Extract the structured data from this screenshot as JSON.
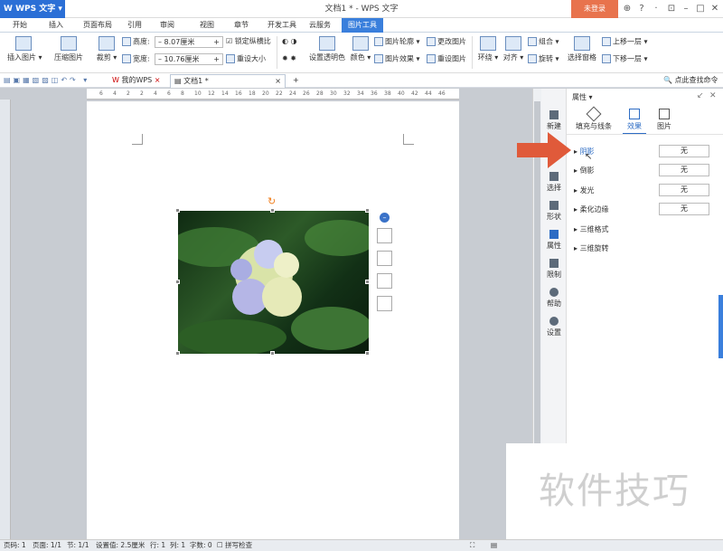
{
  "app": {
    "name": "WPS 文字",
    "doc_title": "文档1 * - WPS 文字",
    "login": "未登录"
  },
  "tabs": [
    "开始",
    "插入",
    "页面布局",
    "引用",
    "审阅",
    "视图",
    "章节",
    "开发工具",
    "云服务",
    "图片工具"
  ],
  "active_tab": "图片工具",
  "ribbon": {
    "insert_image": "插入图片",
    "compress": "压缩图片",
    "crop": "裁剪",
    "height_label": "高度:",
    "height_value": "8.07厘米",
    "width_label": "宽度:",
    "width_value": "10.76厘米",
    "lock_ratio": "锁定纵横比",
    "reset_size": "重设大小",
    "transparent": "设置透明色",
    "color": "颜色",
    "outline": "图片轮廓",
    "effect": "图片效果",
    "change_pic": "更改图片",
    "reset_pic": "重设图片",
    "wrap": "环绕",
    "align": "对齐",
    "rotate": "旋转",
    "group": "组合",
    "select_pane": "选择窗格",
    "bring_forward": "上移一层",
    "send_backward": "下移一层",
    "search_cmd": "点此查找命令"
  },
  "doc_tabs": [
    {
      "label": "我的WPS"
    },
    {
      "label": "文档1 *"
    }
  ],
  "ruler_ticks": [
    "6",
    "4",
    "2",
    "2",
    "4",
    "6",
    "8",
    "10",
    "12",
    "14",
    "16",
    "18",
    "20",
    "22",
    "24",
    "26",
    "28",
    "30",
    "32",
    "34",
    "36",
    "38",
    "40",
    "42",
    "44",
    "46"
  ],
  "sidebar": [
    {
      "label": "新建",
      "icon": "new-icon"
    },
    {
      "label": "选择",
      "icon": "select-icon"
    },
    {
      "label": "形状",
      "icon": "shape-icon"
    },
    {
      "label": "属性",
      "icon": "property-icon"
    },
    {
      "label": "限制",
      "icon": "restrict-icon"
    },
    {
      "label": "帮助",
      "icon": "help-icon"
    },
    {
      "label": "设置",
      "icon": "settings-icon"
    }
  ],
  "panel": {
    "title": "属性 ▾",
    "tab_fill": "填充与线条",
    "tab_effect": "效果",
    "tab_picture": "图片",
    "rows": [
      {
        "label": "阴影",
        "value": "无"
      },
      {
        "label": "倒影",
        "value": "无"
      },
      {
        "label": "发光",
        "value": "无"
      },
      {
        "label": "柔化边缘",
        "value": "无"
      },
      {
        "label": "三维格式",
        "value": ""
      },
      {
        "label": "三维旋转",
        "value": ""
      }
    ]
  },
  "status": {
    "pagenum": "页码: 1",
    "page": "页面: 1/1",
    "section": "节: 1/1",
    "setting": "设置值: 2.5厘米",
    "row": "行: 1",
    "col": "列: 1",
    "words": "字数: 0",
    "spell": "拼写检查"
  },
  "watermark": "软件技巧",
  "colors": {
    "accent": "#3a7fdc",
    "login": "#e8734d",
    "arrow": "#e05a3a"
  }
}
